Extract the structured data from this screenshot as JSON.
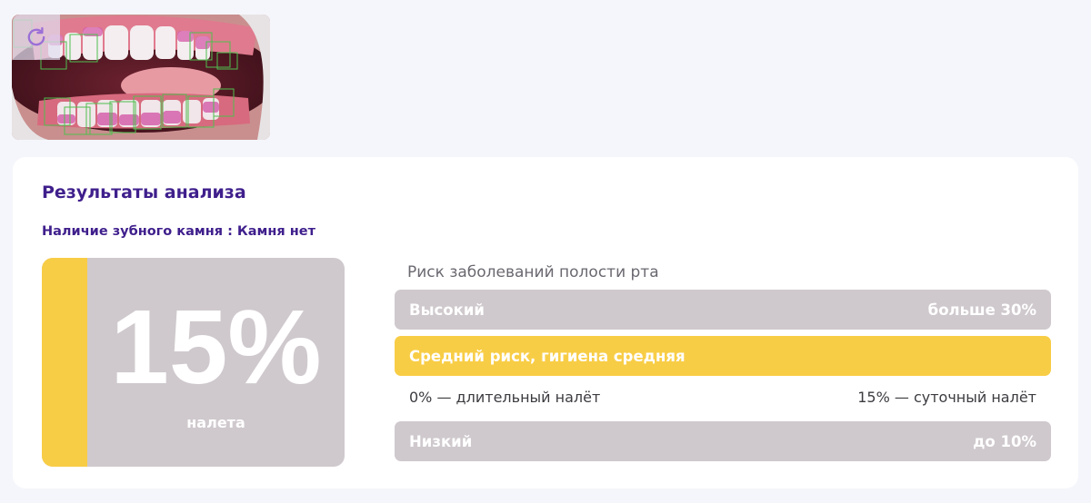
{
  "image": {
    "refresh_icon": "refresh-icon",
    "accent": "#9b6fd6"
  },
  "results": {
    "title": "Результаты анализа",
    "tartar_label": "Наличие зубного камня",
    "tartar_separator": ":",
    "tartar_value": "Камня нет",
    "plaque_percent": "15%",
    "plaque_label": "налета",
    "plaque_fraction": 0.15
  },
  "risk": {
    "title": "Риск заболеваний полости рта",
    "high": {
      "label": "Высокий",
      "range": "больше 30%"
    },
    "medium": {
      "label": "Средний риск, гигиена средняя"
    },
    "legend_left": "0% — длительный налёт",
    "legend_right": "15% — суточный налёт",
    "low": {
      "label": "Низкий",
      "range": "до 10%"
    }
  },
  "colors": {
    "accent_purple": "#3f1f8c",
    "highlight_yellow": "#f8cd46",
    "neutral_gray": "#cfc9cd",
    "background": "#f5f6fb"
  }
}
